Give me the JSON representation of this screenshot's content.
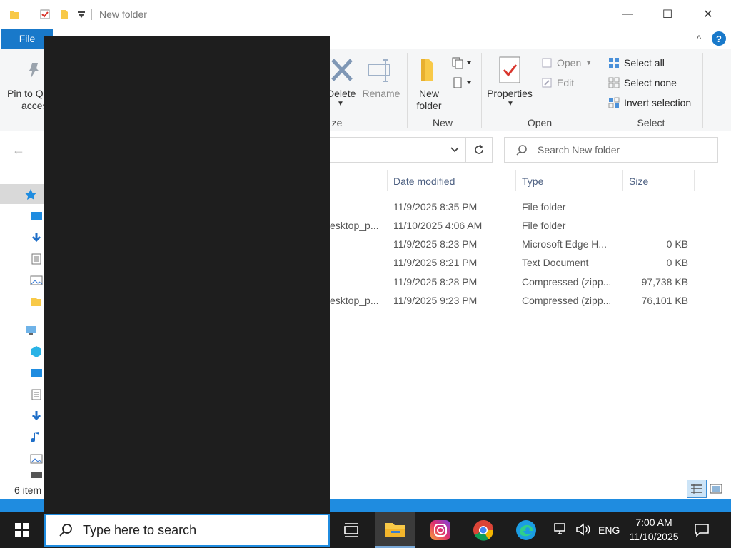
{
  "window": {
    "title": "New folder",
    "minimize_symbol": "—",
    "maximize_symbol": "☐",
    "close_symbol": "✕"
  },
  "ribbon": {
    "file_tab": "File",
    "help_symbol": "?",
    "collapse_symbol": "^",
    "pin_label_1": "Pin to Q",
    "pin_label_2": "acces",
    "delete_label": "Delete",
    "rename_label": "Rename",
    "organize_group_fragment": "ze",
    "new_folder_label_1": "New",
    "new_folder_label_2": "folder",
    "new_group": "New",
    "properties_label": "Properties",
    "open_label": "Open",
    "edit_label": "Edit",
    "open_group": "Open",
    "select_all": "Select all",
    "select_none": "Select none",
    "invert_selection": "Invert selection",
    "select_group": "Select"
  },
  "addressbar": {
    "search_placeholder": "Search New folder"
  },
  "columns": {
    "date_modified": "Date modified",
    "type": "Type",
    "size": "Size"
  },
  "files": [
    {
      "name": "",
      "date": "11/9/2025 8:35 PM",
      "type": "File folder",
      "size": ""
    },
    {
      "name": "esktop_p...",
      "date": "11/10/2025 4:06 AM",
      "type": "File folder",
      "size": ""
    },
    {
      "name": "",
      "date": "11/9/2025 8:23 PM",
      "type": "Microsoft Edge H...",
      "size": "0 KB"
    },
    {
      "name": "",
      "date": "11/9/2025 8:21 PM",
      "type": "Text Document",
      "size": "0 KB"
    },
    {
      "name": "",
      "date": "11/9/2025 8:28 PM",
      "type": "Compressed (zipp...",
      "size": "97,738 KB"
    },
    {
      "name": "esktop_p...",
      "date": "11/9/2025 9:23 PM",
      "type": "Compressed (zipp...",
      "size": "76,101 KB"
    }
  ],
  "statusbar": {
    "item_count": "6 item"
  },
  "taskbar": {
    "search_placeholder": "Type here to search",
    "language": "ENG",
    "time": "7:00 AM",
    "date": "11/10/2025"
  },
  "colors": {
    "accent": "#1979ca",
    "taskbar": "#1c1c1c",
    "overlay": "#1e1e1e"
  }
}
